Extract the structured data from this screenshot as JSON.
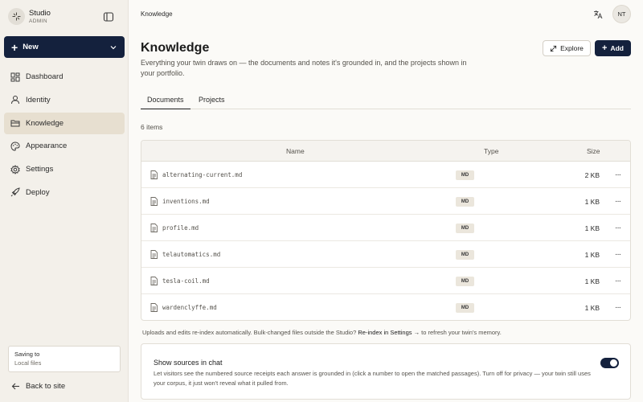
{
  "brand": {
    "name": "Studio",
    "role": "ADMIN"
  },
  "sidebar": {
    "new_label": "New",
    "items": [
      {
        "label": "Dashboard",
        "icon": "dashboard-icon"
      },
      {
        "label": "Identity",
        "icon": "user-icon"
      },
      {
        "label": "Knowledge",
        "icon": "folder-icon",
        "active": true
      },
      {
        "label": "Appearance",
        "icon": "palette-icon"
      },
      {
        "label": "Settings",
        "icon": "gear-icon"
      },
      {
        "label": "Deploy",
        "icon": "rocket-icon"
      }
    ],
    "saving_title": "Saving to",
    "saving_target": "Local files",
    "back_label": "Back to site"
  },
  "topbar": {
    "breadcrumb": "Knowledge",
    "avatar_initials": "NT"
  },
  "page": {
    "title": "Knowledge",
    "subtitle": "Everything your twin draws on — the documents and notes it's grounded in, and the projects shown in your portfolio.",
    "explore_label": "Explore",
    "add_label": "Add",
    "tabs": [
      {
        "label": "Documents",
        "active": true
      },
      {
        "label": "Projects"
      }
    ],
    "count_text": "6 items"
  },
  "table": {
    "headers": {
      "name": "Name",
      "type": "Type",
      "size": "Size"
    },
    "rows": [
      {
        "name": "alternating-current.md",
        "type": "MD",
        "size": "2 KB"
      },
      {
        "name": "inventions.md",
        "type": "MD",
        "size": "1 KB"
      },
      {
        "name": "profile.md",
        "type": "MD",
        "size": "1 KB"
      },
      {
        "name": "telautomatics.md",
        "type": "MD",
        "size": "1 KB"
      },
      {
        "name": "tesla-coil.md",
        "type": "MD",
        "size": "1 KB"
      },
      {
        "name": "wardenclyffe.md",
        "type": "MD",
        "size": "1 KB"
      }
    ],
    "more_glyph": "···"
  },
  "note": {
    "text": "Uploads and edits re-index automatically. Bulk-changed files outside the Studio?",
    "link": "Re-index in Settings →",
    "suffix": "to refresh your twin's memory."
  },
  "sources": {
    "title": "Show sources in chat",
    "description": "Let visitors see the numbered source receipts each answer is grounded in (click a number to open the matched passages). Turn off for privacy — your twin still uses your corpus, it just won't reveal what it pulled from.",
    "enabled": true
  },
  "colors": {
    "accent": "#14213d",
    "active_nav": "#e7dfd0",
    "sidebar_bg": "#f3f0ea"
  }
}
